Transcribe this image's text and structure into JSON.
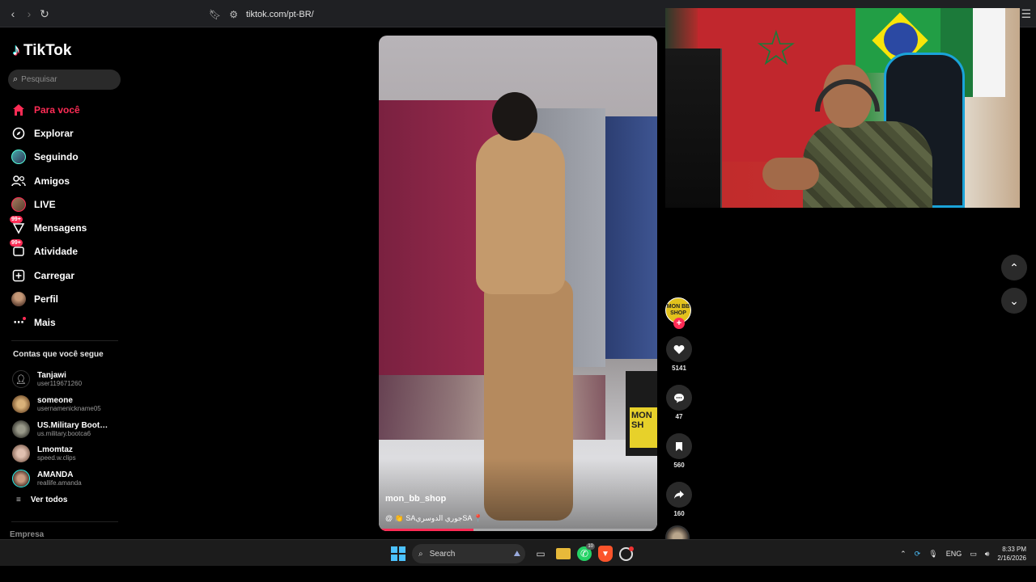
{
  "browser": {
    "url": "tiktok.com/pt-BR/"
  },
  "sidebar": {
    "logo": "TikTok",
    "search_placeholder": "Pesquisar",
    "nav": [
      {
        "label": "Para você",
        "icon": "home-icon",
        "active": true
      },
      {
        "label": "Explorar",
        "icon": "compass-icon"
      },
      {
        "label": "Seguindo",
        "icon": "avatar-icon"
      },
      {
        "label": "Amigos",
        "icon": "friends-icon"
      },
      {
        "label": "LIVE",
        "icon": "live-icon"
      },
      {
        "label": "Mensagens",
        "icon": "messages-icon",
        "badge": "99+"
      },
      {
        "label": "Atividade",
        "icon": "activity-icon",
        "badge": "99+"
      },
      {
        "label": "Carregar",
        "icon": "upload-icon"
      },
      {
        "label": "Perfil",
        "icon": "profile-icon"
      },
      {
        "label": "Mais",
        "icon": "more-icon"
      }
    ],
    "following_title": "Contas que você segue",
    "following": [
      {
        "name": "Tanjawi",
        "handle": "user119671260"
      },
      {
        "name": "someone",
        "handle": "usernamenickname05"
      },
      {
        "name": "US.Military Bootca...",
        "handle": "us.military.bootca6"
      },
      {
        "name": "Lmomtaz",
        "handle": "speed.w.clips"
      },
      {
        "name": "AMANDA",
        "handle": "reallife.amanda"
      }
    ],
    "see_all": "Ver todos",
    "company": "Empresa"
  },
  "video": {
    "author": "mon_bb_shop",
    "description": "@ 👏 SAجوري الدوسريSA 📍",
    "progress": 0.34,
    "box_label": "MON SH"
  },
  "actions": {
    "creator_avatar_text": "MON BB SHOP",
    "likes": "5141",
    "comments": "47",
    "saves": "560",
    "shares": "160"
  },
  "taskbar": {
    "search": "Search",
    "whatsapp_badge": "10",
    "lang": "ENG",
    "time": "8:33 PM",
    "date": "2/16/2026"
  },
  "colors": {
    "accent": "#fe2c55",
    "windows_blue": "#4cc2ff"
  }
}
